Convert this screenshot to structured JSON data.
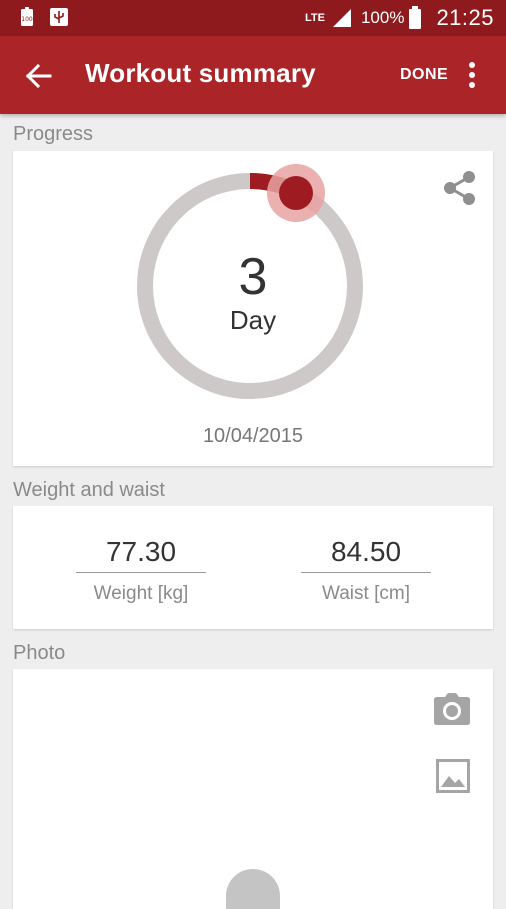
{
  "status_bar": {
    "network": "LTE",
    "battery_percent": "100%",
    "time": "21:25",
    "icons": [
      "battery-100-icon",
      "usb-icon",
      "signal-icon",
      "battery-icon"
    ]
  },
  "app_bar": {
    "title": "Workout summary",
    "done_label": "DONE",
    "icons": [
      "back-arrow-icon",
      "overflow-menu-icon"
    ],
    "color": "#ab2528"
  },
  "progress": {
    "section_label": "Progress",
    "day_number": "3",
    "day_unit": "Day",
    "date": "10/04/2015",
    "share_icon": "share-icon",
    "ring_colors": {
      "track": "#cdc9c9",
      "fill": "#9e1b22",
      "knob": "#9e1b22",
      "knob_halo": "#e8a2a2"
    }
  },
  "weight_waist": {
    "section_label": "Weight and waist",
    "weight_value": "77.30",
    "weight_label": "Weight [kg]",
    "waist_value": "84.50",
    "waist_label": "Waist [cm]"
  },
  "photo": {
    "section_label": "Photo",
    "icons": [
      "camera-icon",
      "image-icon",
      "avatar-icon"
    ]
  }
}
